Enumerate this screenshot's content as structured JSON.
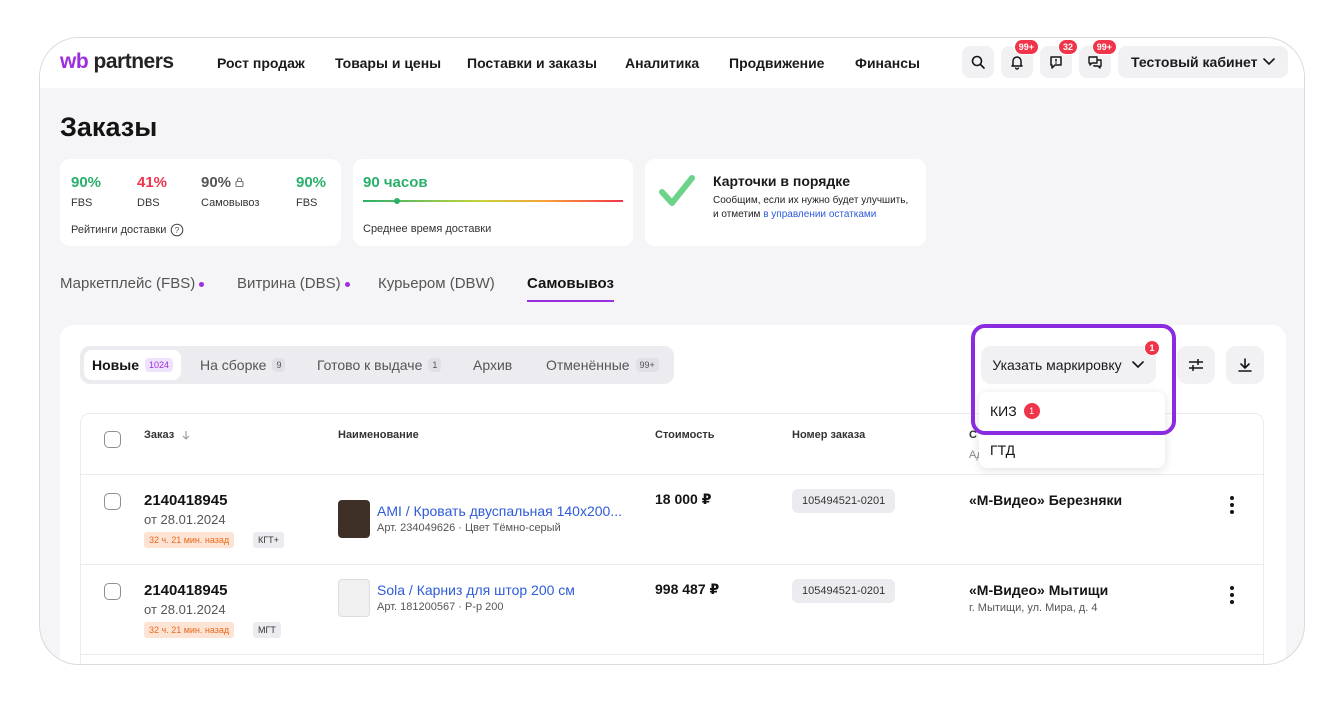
{
  "brand": {
    "wb": "wb",
    "name": "partners"
  },
  "nav": [
    "Рост продаж",
    "Товары и цены",
    "Поставки и заказы",
    "Аналитика",
    "Продвижение",
    "Финансы"
  ],
  "header": {
    "notifications_badge": "99+",
    "messages_badge": "32",
    "chat_badge": "99+",
    "cabinet": "Тестовый кабинет"
  },
  "page_title": "Заказы",
  "ratings": {
    "items": [
      {
        "value": "90%",
        "label": "FBS"
      },
      {
        "value": "41%",
        "label": "DBS"
      },
      {
        "value": "90%",
        "label": "Самовывоз"
      },
      {
        "value": "90%",
        "label": "FBS"
      }
    ],
    "caption": "Рейтинги доставки"
  },
  "delivery_time": {
    "value": "90 часов",
    "caption": "Среднее время доставки",
    "progress": 0.12
  },
  "cards_status": {
    "title": "Карточки в порядке",
    "text": "Сообщим, если их нужно будет улучшить, и отметим",
    "link_1": "в управлении",
    "link_2": "остатками"
  },
  "main_tabs": [
    {
      "label": "Маркетплейс (FBS)",
      "dot": true
    },
    {
      "label": "Витрина (DBS)",
      "dot": true
    },
    {
      "label": "Курьером (DBW)",
      "dot": false
    },
    {
      "label": "Самовывоз",
      "dot": false,
      "active": true
    }
  ],
  "segments": [
    {
      "label": "Новые",
      "count": "1024",
      "active": true
    },
    {
      "label": "На сборке",
      "count": "9"
    },
    {
      "label": "Готово к выдаче",
      "count": "1"
    },
    {
      "label": "Архив",
      "count": ""
    },
    {
      "label": "Отменённые",
      "count": "99+"
    }
  ],
  "marking": {
    "button": "Указать маркировку",
    "badge": "1",
    "options": [
      {
        "label": "КИЗ",
        "badge": "1"
      },
      {
        "label": "ГТД",
        "badge": ""
      }
    ]
  },
  "table": {
    "headers": [
      "Заказ",
      "Наименование",
      "Стоимость",
      "Номер заказа",
      "С",
      "Ад"
    ],
    "rows": [
      {
        "order": "2140418945",
        "date": "от 28.01.2024",
        "timer": "32 ч. 21 мин. назад",
        "tag": "КГТ+",
        "product": "AMI / Кровать двуспальная 140х200...",
        "sub": "Арт. 234049626 · Цвет Тёмно-серый",
        "price": "18 000 ₽",
        "number": "105494521-0201",
        "store": "«М-Видео» Березняки",
        "address": ""
      },
      {
        "order": "2140418945",
        "date": "от 28.01.2024",
        "timer": "32 ч. 21 мин. назад",
        "tag": "МГТ",
        "product": "Sola / Карниз для штор 200 см",
        "sub": "Арт. 181200567 · Р-р 200",
        "price": "998 487 ₽",
        "number": "105494521-0201",
        "store": "«М-Видео» Мытищи",
        "address": "г. Мытищи, ул. Мира, д. 4"
      }
    ]
  },
  "colors": {
    "accent": "#9b2fe0",
    "green": "#2bb06b",
    "red": "#f0344a",
    "link": "#2e5bd8"
  }
}
